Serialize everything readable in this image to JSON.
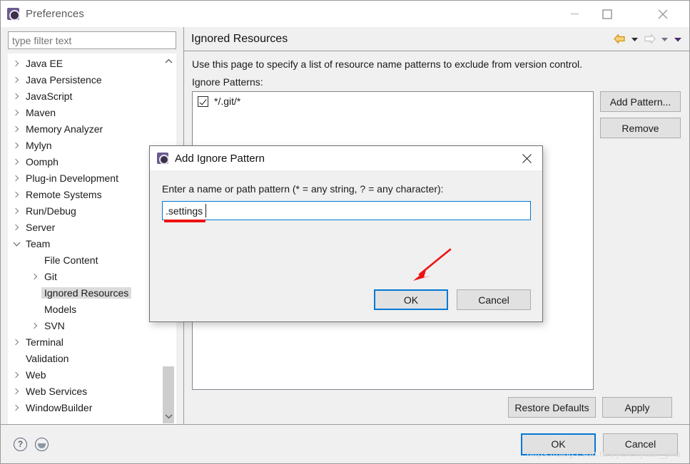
{
  "window": {
    "title": "Preferences",
    "icon": "gear-icon",
    "controls": {
      "minimize": "minimize-icon",
      "maximize": "maximize-icon",
      "close": "close-icon"
    }
  },
  "sidebar": {
    "filter": {
      "placeholder": "type filter text",
      "value": ""
    },
    "items": [
      {
        "label": "Java EE",
        "level": 1,
        "expander": "collapsed",
        "selected": false
      },
      {
        "label": "Java Persistence",
        "level": 1,
        "expander": "collapsed",
        "selected": false
      },
      {
        "label": "JavaScript",
        "level": 1,
        "expander": "collapsed",
        "selected": false
      },
      {
        "label": "Maven",
        "level": 1,
        "expander": "collapsed",
        "selected": false
      },
      {
        "label": "Memory Analyzer",
        "level": 1,
        "expander": "collapsed",
        "selected": false
      },
      {
        "label": "Mylyn",
        "level": 1,
        "expander": "collapsed",
        "selected": false
      },
      {
        "label": "Oomph",
        "level": 1,
        "expander": "collapsed",
        "selected": false
      },
      {
        "label": "Plug-in Development",
        "level": 1,
        "expander": "collapsed",
        "selected": false
      },
      {
        "label": "Remote Systems",
        "level": 1,
        "expander": "collapsed",
        "selected": false
      },
      {
        "label": "Run/Debug",
        "level": 1,
        "expander": "collapsed",
        "selected": false
      },
      {
        "label": "Server",
        "level": 1,
        "expander": "collapsed",
        "selected": false
      },
      {
        "label": "Team",
        "level": 1,
        "expander": "expanded",
        "selected": false
      },
      {
        "label": "File Content",
        "level": 2,
        "expander": "none",
        "selected": false
      },
      {
        "label": "Git",
        "level": 2,
        "expander": "collapsed",
        "selected": false
      },
      {
        "label": "Ignored Resources",
        "level": 2,
        "expander": "none",
        "selected": true
      },
      {
        "label": "Models",
        "level": 2,
        "expander": "none",
        "selected": false
      },
      {
        "label": "SVN",
        "level": 2,
        "expander": "collapsed",
        "selected": false
      },
      {
        "label": "Terminal",
        "level": 1,
        "expander": "collapsed",
        "selected": false
      },
      {
        "label": "Validation",
        "level": 1,
        "expander": "none",
        "selected": false
      },
      {
        "label": "Web",
        "level": 1,
        "expander": "collapsed",
        "selected": false
      },
      {
        "label": "Web Services",
        "level": 1,
        "expander": "collapsed",
        "selected": false
      },
      {
        "label": "WindowBuilder",
        "level": 1,
        "expander": "collapsed",
        "selected": false
      }
    ],
    "scrollbar": {
      "up": "chevron-up-icon",
      "down": "chevron-down-icon"
    }
  },
  "page": {
    "title": "Ignored Resources",
    "description": "Use this page to specify a list of resource name patterns to exclude from version control.",
    "patterns_label": "Ignore Patterns:",
    "nav": {
      "back": "back-arrow-icon",
      "back_menu": "chevron-down-icon",
      "forward": "forward-arrow-icon",
      "forward_menu": "chevron-down-icon",
      "view_menu": "chevron-down-icon",
      "back_color": "#e8a317",
      "forward_color": "#c8c8c8"
    },
    "patterns": [
      {
        "label": "*/.git/*",
        "checked": true
      }
    ],
    "buttons": {
      "add_pattern": "Add Pattern...",
      "remove": "Remove"
    },
    "footer_buttons": {
      "restore_defaults": "Restore Defaults",
      "apply": "Apply"
    }
  },
  "bottom_bar": {
    "help_icon": "?",
    "pin_icon": "pin-icon",
    "ok": "OK",
    "cancel": "Cancel"
  },
  "modal": {
    "title": "Add Ignore Pattern",
    "icon": "gear-icon",
    "close": "close-icon",
    "prompt": "Enter a name or path pattern (* = any string, ? = any character):",
    "input": {
      "value": ".settings",
      "placeholder": ""
    },
    "ok": "OK",
    "cancel": "Cancel"
  },
  "annotations": {
    "arrow_color": "#ee1111",
    "underline_color": "#ee1111"
  },
  "watermark": "https://blog.csdn.net/yerenyuan_pku"
}
